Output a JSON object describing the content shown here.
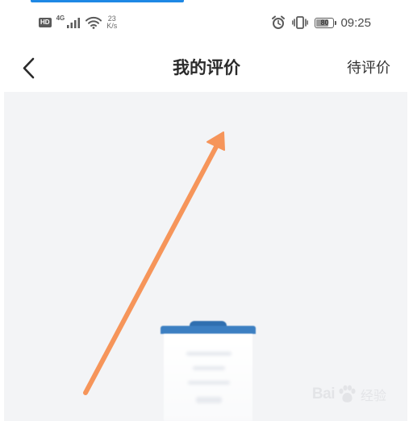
{
  "status_bar": {
    "hd_label": "HD",
    "network_gen": "4G",
    "speed_value": "23",
    "speed_unit": "K/s",
    "battery_level": 80,
    "battery_label": "80",
    "time": "09:25",
    "icons": [
      "signal-icon",
      "wifi-icon",
      "alarm-icon",
      "vibrate-icon",
      "battery-icon"
    ]
  },
  "header": {
    "back_icon": "chevron-left-icon",
    "title": "我的评价",
    "action_label": "待评价"
  },
  "content": {
    "illustration": "empty-clipboard-icon",
    "annotation": "arrow-icon",
    "accent_color": "#f6955a"
  },
  "watermark": {
    "logo_text": "Bai",
    "logo_icon": "paw-icon",
    "logo_suffix": "经验"
  },
  "colors": {
    "accent_blue": "#1e88e5",
    "clipboard_blue": "#3c7fc2",
    "content_bg": "#f3f4f6"
  }
}
